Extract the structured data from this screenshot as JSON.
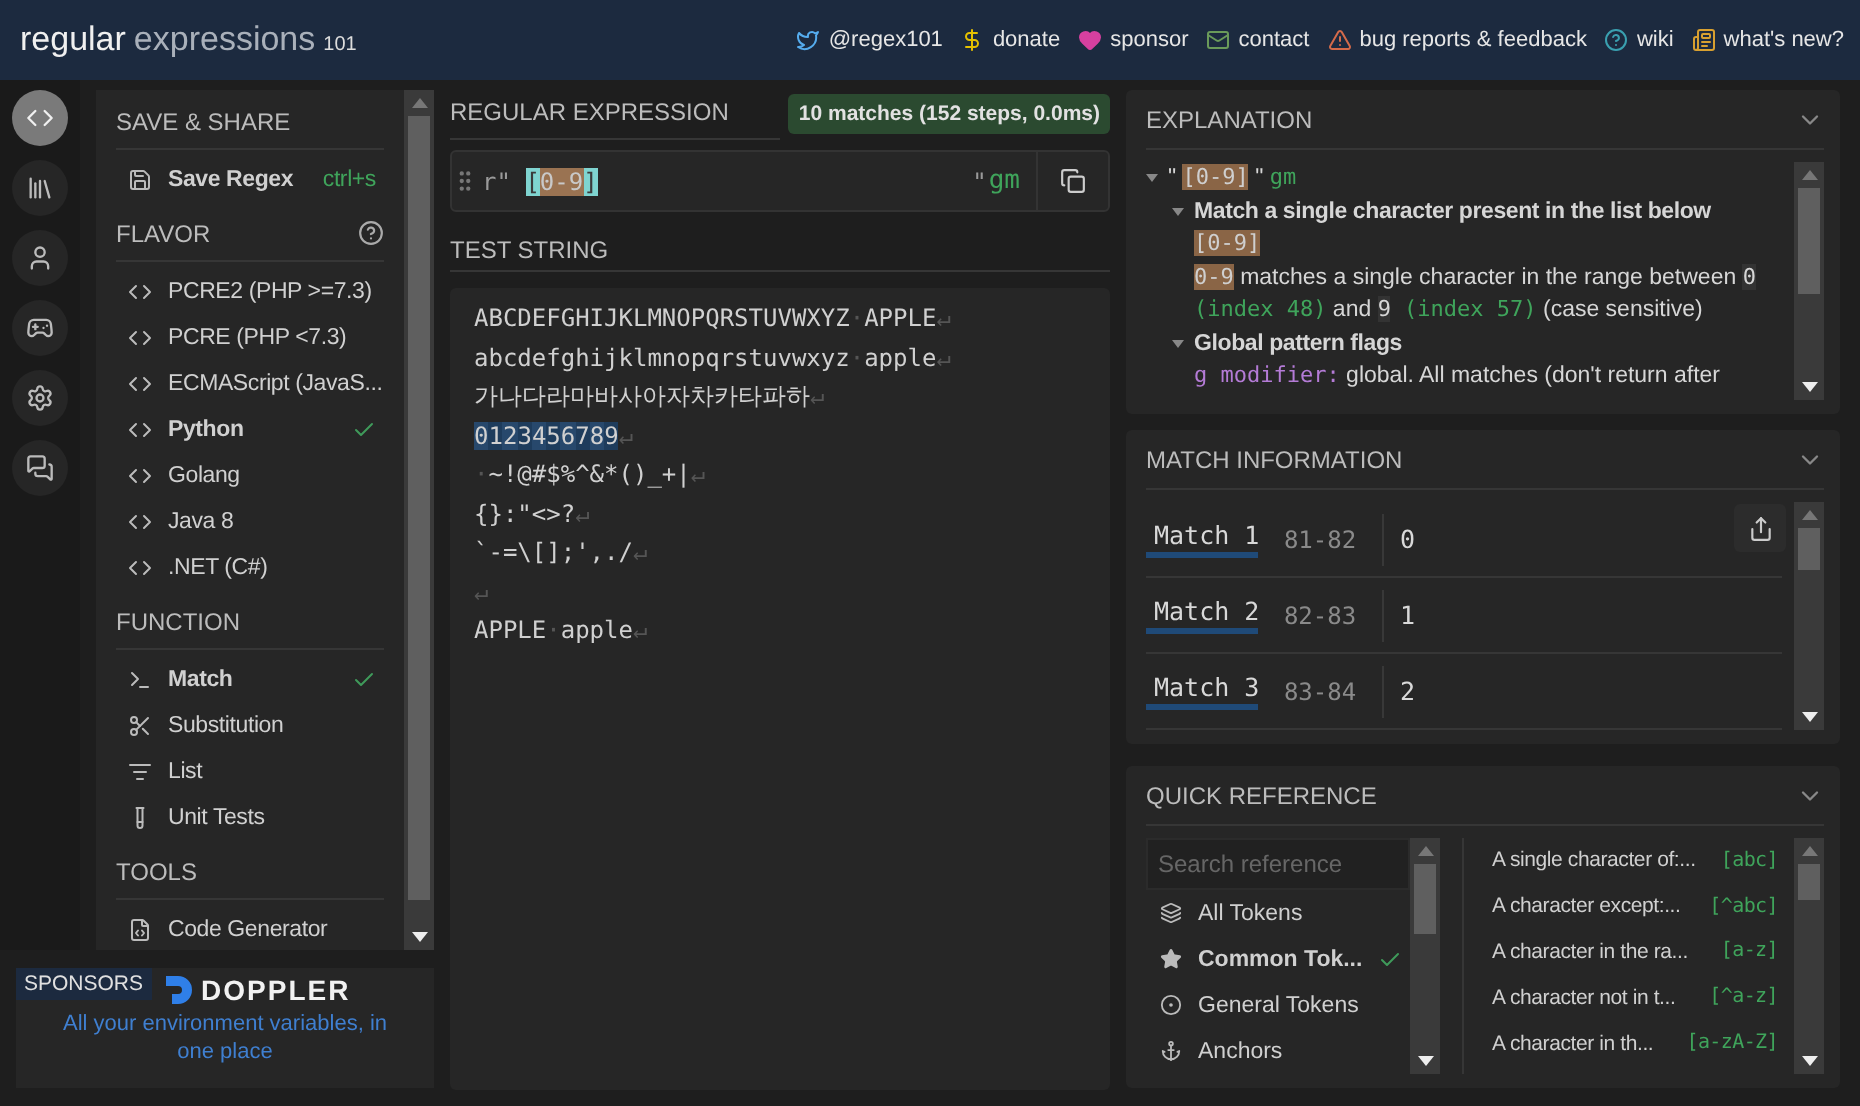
{
  "header": {
    "logo": {
      "main": "regular",
      "sub": "expressions",
      "version": "101"
    },
    "links": [
      {
        "label": "@regex101"
      },
      {
        "label": "donate"
      },
      {
        "label": "sponsor"
      },
      {
        "label": "contact"
      },
      {
        "label": "bug reports & feedback"
      },
      {
        "label": "wiki"
      },
      {
        "label": "what's new?"
      }
    ]
  },
  "rail": [
    {
      "selected": true
    },
    {
      "selected": false
    },
    {
      "selected": false
    },
    {
      "selected": false
    },
    {
      "selected": false
    },
    {
      "selected": false
    }
  ],
  "sidebar": {
    "sections": [
      {
        "title": "SAVE & SHARE",
        "kind": "save",
        "items": [
          {
            "label": "Save Regex",
            "shortcut": "ctrl+s"
          }
        ]
      },
      {
        "title": "FLAVOR",
        "kind": "flavor",
        "items": [
          {
            "label": "PCRE2 (PHP >=7.3)",
            "selected": false
          },
          {
            "label": "PCRE (PHP <7.3)",
            "selected": false
          },
          {
            "label": "ECMAScript (JavaS...",
            "selected": false
          },
          {
            "label": "Python",
            "selected": true
          },
          {
            "label": "Golang",
            "selected": false
          },
          {
            "label": "Java 8",
            "selected": false
          },
          {
            "label": ".NET (C#)",
            "selected": false
          }
        ]
      },
      {
        "title": "FUNCTION",
        "kind": "function",
        "items": [
          {
            "label": "Match",
            "selected": true
          },
          {
            "label": "Substitution",
            "selected": false
          },
          {
            "label": "List",
            "selected": false
          },
          {
            "label": "Unit Tests",
            "selected": false
          }
        ]
      },
      {
        "title": "TOOLS",
        "kind": "tools",
        "items": [
          {
            "label": "Code Generator"
          }
        ]
      }
    ]
  },
  "sponsors": {
    "badge": "SPONSORS",
    "brand": "DOPPLER",
    "tagline": "All your environment variables, in one place"
  },
  "regex": {
    "title": "REGULAR EXPRESSION",
    "status": "10 matches (152 steps, 0.0ms)",
    "prefix": "r\"",
    "pattern": [
      {
        "text": "[",
        "kind": "bracket"
      },
      {
        "text": "0",
        "kind": "range"
      },
      {
        "text": "-",
        "kind": "range"
      },
      {
        "text": "9",
        "kind": "range"
      },
      {
        "text": "]",
        "kind": "bracket"
      }
    ],
    "suffix": "\"",
    "flags": "gm"
  },
  "test_string": {
    "title": "TEST STRING",
    "lines": [
      {
        "segments": [
          {
            "text": "ABCDEFGHIJKLMNOPQRSTUVWXYZ",
            "kind": "text"
          },
          {
            "text": "·",
            "kind": "space"
          },
          {
            "text": "APPLE",
            "kind": "text"
          },
          {
            "text": "↵",
            "kind": "eol"
          }
        ]
      },
      {
        "segments": [
          {
            "text": "abcdefghijklmnopqrstuvwxyz",
            "kind": "text"
          },
          {
            "text": "·",
            "kind": "space"
          },
          {
            "text": "apple",
            "kind": "text"
          },
          {
            "text": "↵",
            "kind": "eol"
          }
        ]
      },
      {
        "segments": [
          {
            "text": "가나다라마바사아자차카타파하",
            "kind": "text"
          },
          {
            "text": "↵",
            "kind": "eol"
          }
        ]
      },
      {
        "segments": [
          {
            "text": "0",
            "kind": "match"
          },
          {
            "text": "1",
            "kind": "match"
          },
          {
            "text": "2",
            "kind": "match"
          },
          {
            "text": "3",
            "kind": "match"
          },
          {
            "text": "4",
            "kind": "match"
          },
          {
            "text": "5",
            "kind": "match"
          },
          {
            "text": "6",
            "kind": "match"
          },
          {
            "text": "7",
            "kind": "match"
          },
          {
            "text": "8",
            "kind": "match"
          },
          {
            "text": "9",
            "kind": "match"
          },
          {
            "text": "↵",
            "kind": "eol"
          }
        ]
      },
      {
        "segments": [
          {
            "text": "·",
            "kind": "space"
          },
          {
            "text": "~!@#$%^&*()_+|",
            "kind": "text"
          },
          {
            "text": "↵",
            "kind": "eol"
          }
        ]
      },
      {
        "segments": [
          {
            "text": "{}:\"<>?",
            "kind": "text"
          },
          {
            "text": "↵",
            "kind": "eol"
          }
        ]
      },
      {
        "segments": [
          {
            "text": "`-=\\[];',./",
            "kind": "text"
          },
          {
            "text": "↵",
            "kind": "eol"
          }
        ]
      },
      {
        "segments": [
          {
            "text": "↵",
            "kind": "eol"
          }
        ]
      },
      {
        "segments": [
          {
            "text": "APPLE",
            "kind": "text"
          },
          {
            "text": "·",
            "kind": "space"
          },
          {
            "text": "apple",
            "kind": "text"
          },
          {
            "text": "↵",
            "kind": "eol"
          }
        ]
      }
    ]
  },
  "explanation": {
    "title": "EXPLANATION",
    "root": {
      "expanded": true,
      "segments": [
        {
          "text": "\" ",
          "kind": "text"
        },
        {
          "text": "[0-9]",
          "kind": "token"
        },
        {
          "text": " \" ",
          "kind": "text"
        },
        {
          "text": "gm",
          "kind": "flag"
        }
      ],
      "children": [
        {
          "expanded": true,
          "title": "Match a single character present in the list below",
          "lines": [
            [
              {
                "text": "[0-9]",
                "kind": "token"
              }
            ],
            [
              {
                "text": "0-9",
                "kind": "token"
              },
              {
                "text": " matches a single character in the range between ",
                "kind": "text"
              },
              {
                "text": "0",
                "kind": "code"
              },
              {
                "text": " (index 48)",
                "kind": "index"
              },
              {
                "text": " and ",
                "kind": "text"
              },
              {
                "text": "9",
                "kind": "code"
              },
              {
                "text": " (index 57)",
                "kind": "index"
              },
              {
                "text": " (case sensitive)",
                "kind": "text"
              }
            ]
          ]
        },
        {
          "expanded": true,
          "title": "Global pattern flags",
          "lines": [
            [
              {
                "text": "g modifier:",
                "kind": "modifier"
              },
              {
                "text": " global. All matches (don't return after",
                "kind": "text"
              }
            ]
          ]
        }
      ]
    }
  },
  "match_info": {
    "title": "MATCH INFORMATION",
    "rows": [
      {
        "label": "Match 1",
        "range": "81-82",
        "value": "0"
      },
      {
        "label": "Match 2",
        "range": "82-83",
        "value": "1"
      },
      {
        "label": "Match 3",
        "range": "83-84",
        "value": "2"
      }
    ]
  },
  "quick_reference": {
    "title": "QUICK REFERENCE",
    "search": {
      "placeholder": "Search reference"
    },
    "categories": [
      {
        "label": "All Tokens",
        "selected": false
      },
      {
        "label": "Common Tok...",
        "selected": true
      },
      {
        "label": "General Tokens",
        "selected": false
      },
      {
        "label": "Anchors",
        "selected": false
      }
    ],
    "tokens": [
      {
        "description": "A single character of:...",
        "token": "[abc]"
      },
      {
        "description": "A character except:...",
        "token": "[^abc]"
      },
      {
        "description": "A character in the ra...",
        "token": "[a-z]"
      },
      {
        "description": "A character not in t...",
        "token": "[^a-z]"
      },
      {
        "description": "A character in th...",
        "token": "[a-zA-Z]"
      }
    ]
  }
}
